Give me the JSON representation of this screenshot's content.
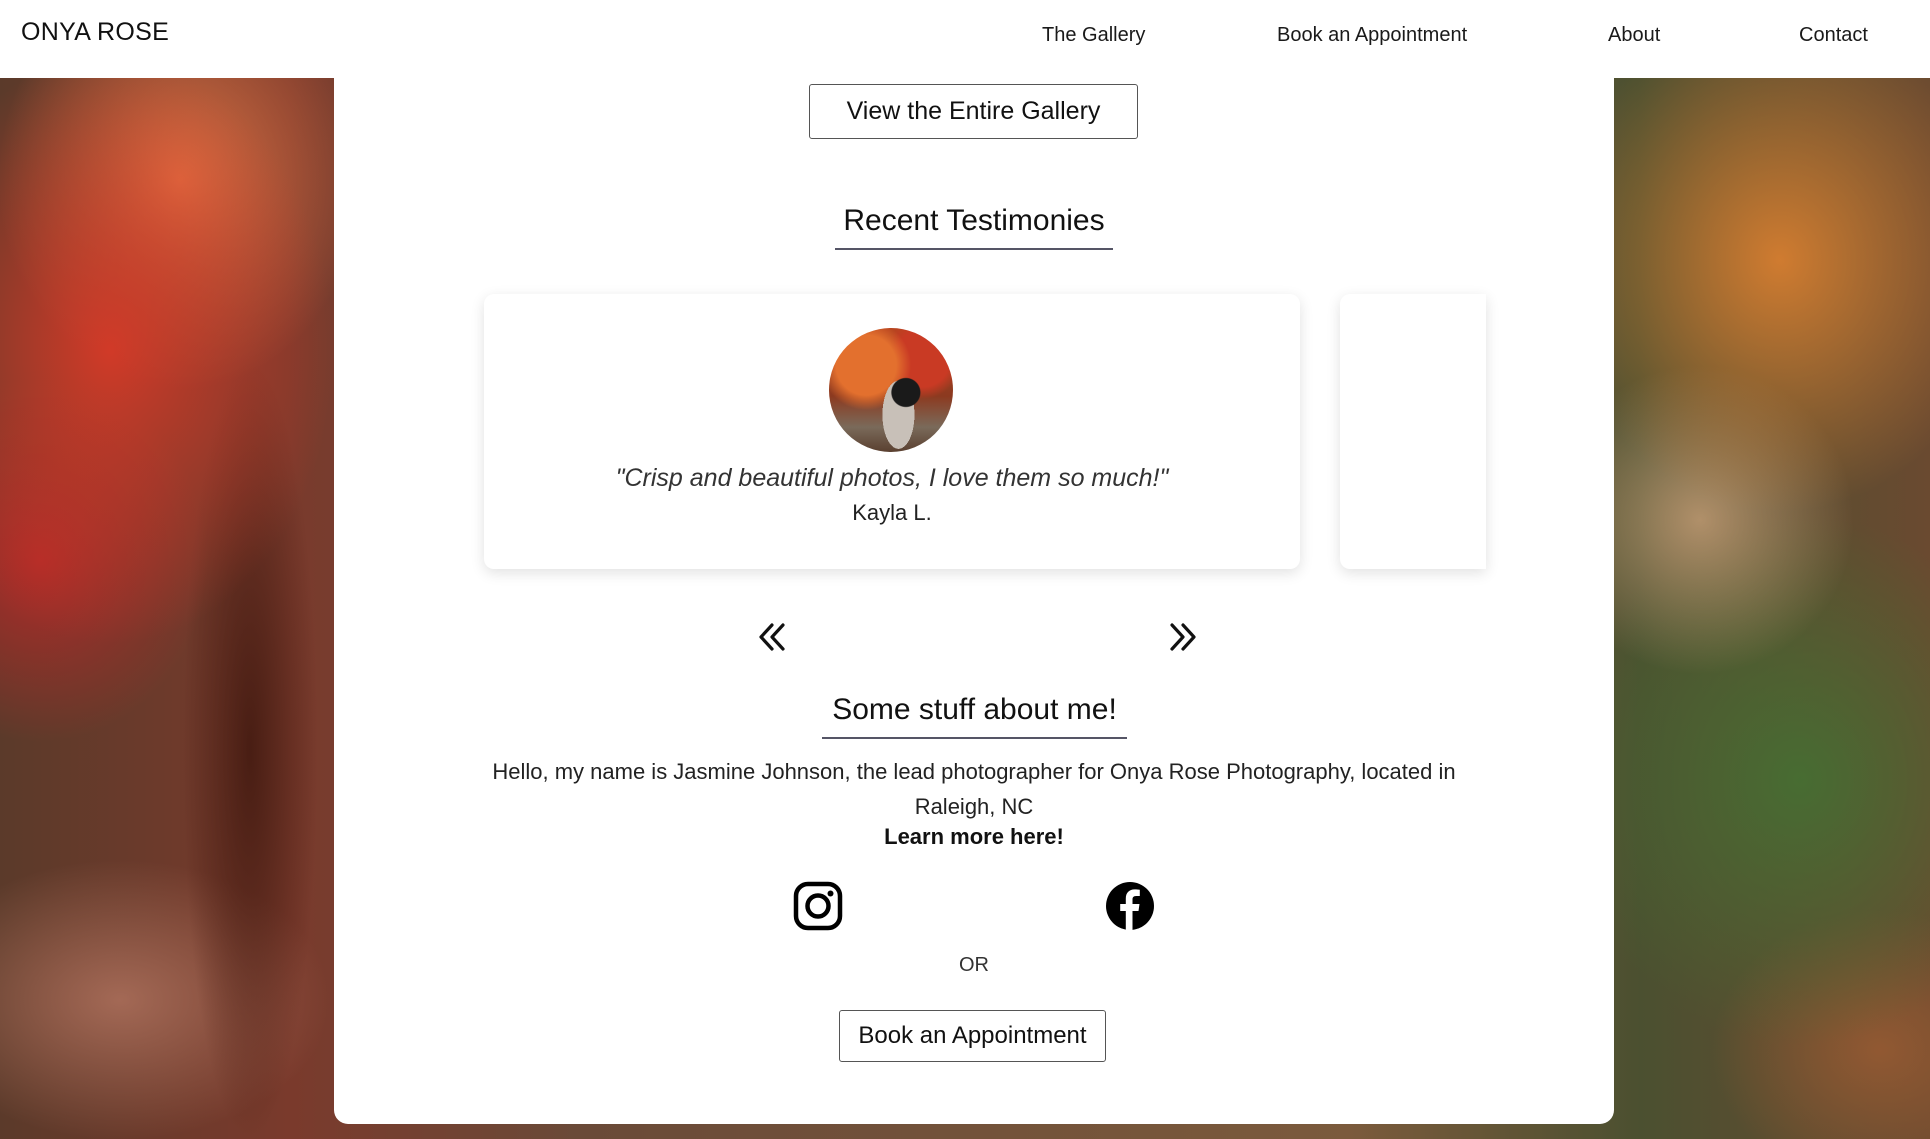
{
  "header": {
    "logo": "ONYA ROSE",
    "nav": [
      {
        "label": "The Gallery"
      },
      {
        "label": "Book an Appointment"
      },
      {
        "label": "About"
      },
      {
        "label": "Contact"
      }
    ]
  },
  "main": {
    "gallery_button": "View the Entire Gallery",
    "testimonies": {
      "title": "Recent Testimonies",
      "items": [
        {
          "quote": "\"Crisp and beautiful photos, I love them so much!\"",
          "author": "Kayla L."
        }
      ],
      "prev_icon": "double-chevron-left-icon",
      "next_icon": "double-chevron-right-icon"
    },
    "about": {
      "title": "Some stuff about me!",
      "text": "Hello, my name is Jasmine Johnson, the lead photographer for Onya Rose Photography, located in Raleigh, NC",
      "learn_more": "Learn more here!"
    },
    "social": {
      "icons": [
        "instagram-icon",
        "facebook-icon"
      ],
      "or_text": "OR"
    },
    "book_button": "Book an Appointment"
  },
  "colors": {
    "text": "#111111",
    "panel": "#ffffff",
    "title_underline": "#555566"
  }
}
